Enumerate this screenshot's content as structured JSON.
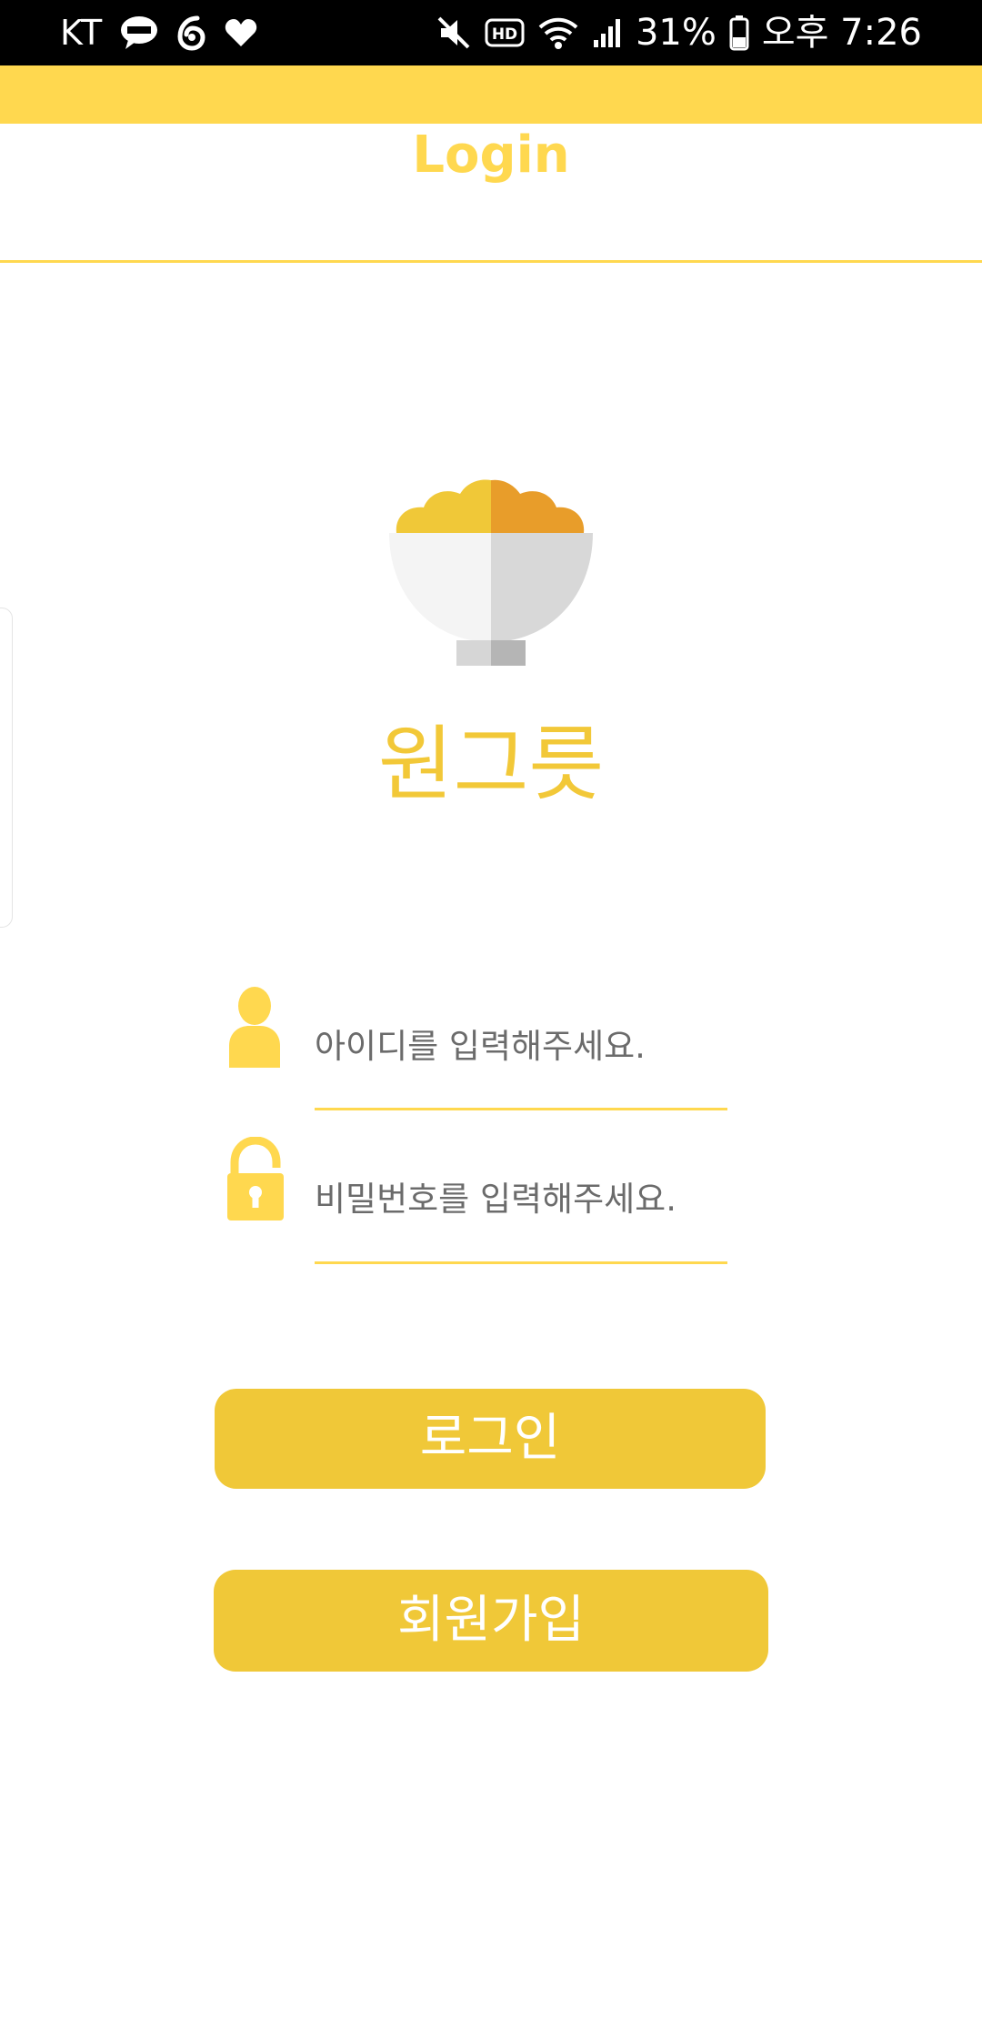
{
  "status_bar": {
    "carrier": "KT",
    "battery": "31%",
    "time": "오후 7:26",
    "left_icons": [
      "kakaotalk-icon",
      "swirl-app-icon",
      "heart-icon"
    ],
    "right_icons": [
      "mute-icon",
      "hd-voice-icon",
      "wifi-icon",
      "signal-icon",
      "battery-icon"
    ]
  },
  "header": {
    "title": "Login"
  },
  "logo": {
    "icon": "rice-bowl-icon",
    "app_name": "원그릇"
  },
  "form": {
    "id_field": {
      "icon": "user-icon",
      "placeholder": "아이디를 입력해주세요.",
      "value": ""
    },
    "password_field": {
      "icon": "unlock-icon",
      "placeholder": "비밀번호를 입력해주세요.",
      "value": ""
    }
  },
  "buttons": {
    "login_label": "로그인",
    "signup_label": "회원가입"
  },
  "colors": {
    "accent": "#ffd84f",
    "button": "#f0c838",
    "status_bar": "#000000",
    "background": "#ffffff"
  }
}
